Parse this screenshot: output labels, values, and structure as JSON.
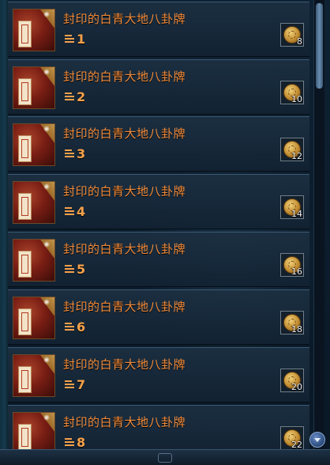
{
  "items": [
    {
      "name": "封印的白青大地八卦牌",
      "level": "1",
      "coin_count": "8"
    },
    {
      "name": "封印的白青大地八卦牌",
      "level": "2",
      "coin_count": "10"
    },
    {
      "name": "封印的白青大地八卦牌",
      "level": "3",
      "coin_count": "12"
    },
    {
      "name": "封印的白青大地八卦牌",
      "level": "4",
      "coin_count": "14"
    },
    {
      "name": "封印的白青大地八卦牌",
      "level": "5",
      "coin_count": "16"
    },
    {
      "name": "封印的白青大地八卦牌",
      "level": "6",
      "coin_count": "18"
    },
    {
      "name": "封印的白青大地八卦牌",
      "level": "7",
      "coin_count": "20"
    },
    {
      "name": "封印的白青大地八卦牌",
      "level": "8",
      "coin_count": "22"
    }
  ],
  "icons": {
    "item": "bagua-tablet-icon",
    "level": "level-bars-icon",
    "currency": "gold-coin-icon",
    "scroll_down": "chevron-down-icon"
  },
  "colors": {
    "item_name": "#f08a3a",
    "level_text": "#f6a14a",
    "row_background": "#1c3042"
  }
}
